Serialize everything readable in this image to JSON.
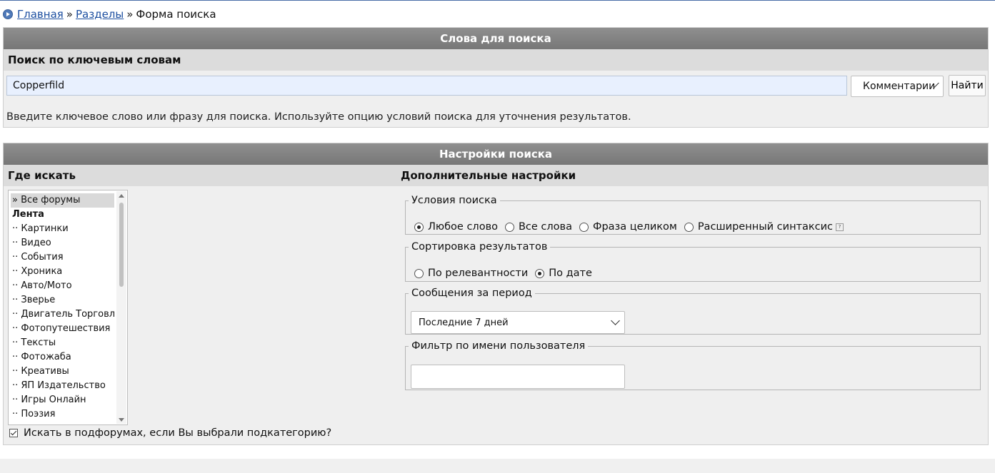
{
  "breadcrumb": {
    "home": "Главная",
    "separator": "»",
    "sections": "Разделы",
    "current": "Форма поиска"
  },
  "search_words": {
    "title": "Слова для поиска",
    "subtitle": "Поиск по ключевым словам",
    "keyword_value": "Copperfild",
    "type_selected": "Комментарии",
    "find_button": "Найти",
    "hint": "Введите ключевое слово или фразу для поиска. Используйте опцию условий поиска для уточнения результатов."
  },
  "settings": {
    "title": "Настройки поиска",
    "where_label": "Где искать",
    "advanced_label": "Дополнительные настройки",
    "forums": [
      {
        "label": "» Все форумы",
        "selected": true,
        "bold": false
      },
      {
        "label": "Лента",
        "selected": false,
        "bold": true
      },
      {
        "label": "·· Картинки",
        "selected": false,
        "bold": false
      },
      {
        "label": "·· Видео",
        "selected": false,
        "bold": false
      },
      {
        "label": "·· События",
        "selected": false,
        "bold": false
      },
      {
        "label": "·· Хроника",
        "selected": false,
        "bold": false
      },
      {
        "label": "·· Авто/Мото",
        "selected": false,
        "bold": false
      },
      {
        "label": "·· Зверье",
        "selected": false,
        "bold": false
      },
      {
        "label": "·· Двигатель Торговли",
        "selected": false,
        "bold": false
      },
      {
        "label": "·· Фотопутешествия",
        "selected": false,
        "bold": false
      },
      {
        "label": "·· Тексты",
        "selected": false,
        "bold": false
      },
      {
        "label": "·· Фотожаба",
        "selected": false,
        "bold": false
      },
      {
        "label": "·· Креативы",
        "selected": false,
        "bold": false
      },
      {
        "label": "·· ЯП Издательство",
        "selected": false,
        "bold": false
      },
      {
        "label": "·· Игры Онлайн",
        "selected": false,
        "bold": false
      },
      {
        "label": "·· Поэзия",
        "selected": false,
        "bold": false
      }
    ],
    "subforums_label": "Искать в подфорумах, если Вы выбрали подкатегорию?",
    "subforums_checked": true,
    "conditions": {
      "legend": "Условия поиска",
      "options": [
        {
          "label": "Любое слово",
          "checked": true
        },
        {
          "label": "Все слова",
          "checked": false
        },
        {
          "label": "Фраза целиком",
          "checked": false
        },
        {
          "label": "Расширенный синтаксис",
          "checked": false
        }
      ],
      "help_glyph": "?"
    },
    "sorting": {
      "legend": "Сортировка результатов",
      "options": [
        {
          "label": "По релевантности",
          "checked": false
        },
        {
          "label": "По дате",
          "checked": true
        }
      ]
    },
    "period": {
      "legend": "Сообщения за период",
      "selected": "Последние 7 дней"
    },
    "user_filter": {
      "legend": "Фильтр по имени пользователя",
      "value": ""
    }
  }
}
